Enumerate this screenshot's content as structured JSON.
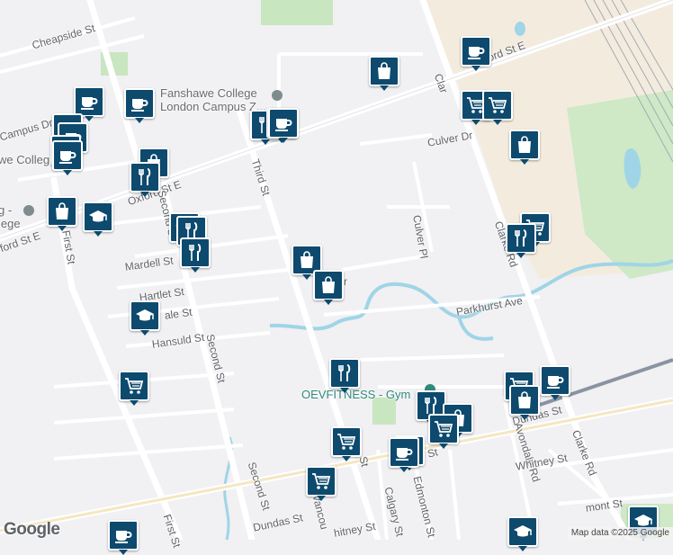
{
  "map": {
    "streets": [
      {
        "id": "cheapside",
        "name": "Cheapside St"
      },
      {
        "id": "oxford-top",
        "name": "ord St E"
      },
      {
        "id": "oxford-mid",
        "name": "Oxford St E"
      },
      {
        "id": "oxford-left",
        "name": "ford St E"
      },
      {
        "id": "campus-dr",
        "name": "Campus Dr"
      },
      {
        "id": "third",
        "name": "Third St"
      },
      {
        "id": "second-upper",
        "name": "Second St"
      },
      {
        "id": "second-lower",
        "name": "Second St"
      },
      {
        "id": "second-bottom",
        "name": "Second St"
      },
      {
        "id": "first",
        "name": "First St"
      },
      {
        "id": "first-bottom",
        "name": "First St"
      },
      {
        "id": "mardell",
        "name": "Mardell St"
      },
      {
        "id": "hartlet",
        "name": "Hartlet St"
      },
      {
        "id": "hansuld",
        "name": "Hansuld St"
      },
      {
        "id": "dale",
        "name": "ale St"
      },
      {
        "id": "culver-dr",
        "name": "Culver Dr"
      },
      {
        "id": "culver-pl",
        "name": "Culver Pl"
      },
      {
        "id": "clarke-top",
        "name": "Clar"
      },
      {
        "id": "clarke-mid",
        "name": "Clarke Rd"
      },
      {
        "id": "clarke-bottom",
        "name": "Clarke Rd"
      },
      {
        "id": "parkhurst",
        "name": "Parkhurst Ave"
      },
      {
        "id": "dundas-right",
        "name": "Dundas St"
      },
      {
        "id": "dundas-left",
        "name": "Dundas St"
      },
      {
        "id": "dundas-mid",
        "name": "as St"
      },
      {
        "id": "avondale",
        "name": "Avondale Rd"
      },
      {
        "id": "whitney",
        "name": "Whitney St"
      },
      {
        "id": "edmonton",
        "name": "Edmonton St"
      },
      {
        "id": "calgary",
        "name": "Calgary St"
      },
      {
        "id": "vancouver",
        "name": "Vancou"
      },
      {
        "id": "whitney-bottom",
        "name": "hitney St"
      },
      {
        "id": "bottom-st",
        "name": "St"
      },
      {
        "id": "belmont",
        "name": "mont St"
      },
      {
        "id": "r-frag",
        "name": "r"
      }
    ],
    "poi_labels": [
      {
        "id": "fanshawe",
        "line1": "Fanshawe College",
        "line2": "London Campus Z..."
      },
      {
        "id": "fanshawe-coll",
        "line1": "we Colleg"
      },
      {
        "id": "college-left",
        "line1": "g -",
        "line2": "lege"
      },
      {
        "id": "gym",
        "line1": "OEVFITNESS - Gym"
      }
    ],
    "pin_types": {
      "cafe": "coffee-cup-icon",
      "restaurant": "fork-knife-icon",
      "shopping": "shopping-bag-icon",
      "grocery": "shopping-cart-icon",
      "school": "graduation-cap-icon"
    },
    "pins": [
      {
        "type": "cafe"
      },
      {
        "type": "shopping"
      },
      {
        "type": "restaurant"
      },
      {
        "type": "grocery"
      },
      {
        "type": "grocery"
      },
      {
        "type": "shopping"
      },
      {
        "type": "cafe"
      },
      {
        "type": "cafe"
      },
      {
        "type": "cafe"
      },
      {
        "type": "cafe"
      },
      {
        "type": "cafe"
      },
      {
        "type": "cafe"
      },
      {
        "type": "restaurant"
      },
      {
        "type": "cafe"
      },
      {
        "type": "shopping"
      },
      {
        "type": "restaurant"
      },
      {
        "type": "shopping"
      },
      {
        "type": "school"
      },
      {
        "type": "school"
      },
      {
        "type": "restaurant"
      },
      {
        "type": "restaurant"
      },
      {
        "type": "shopping"
      },
      {
        "type": "shopping"
      },
      {
        "type": "grocery"
      },
      {
        "type": "restaurant"
      },
      {
        "type": "school"
      },
      {
        "type": "restaurant"
      },
      {
        "type": "grocery"
      },
      {
        "type": "grocery"
      },
      {
        "type": "cafe"
      },
      {
        "type": "shopping"
      },
      {
        "type": "restaurant"
      },
      {
        "type": "shopping"
      },
      {
        "type": "grocery"
      },
      {
        "type": "cafe"
      },
      {
        "type": "grocery"
      },
      {
        "type": "cafe"
      },
      {
        "type": "grocery"
      },
      {
        "type": "school"
      },
      {
        "type": "cafe"
      },
      {
        "type": "school"
      }
    ],
    "colors": {
      "land": "#f1f0f3",
      "road": "#ffffff",
      "water": "#9fd5e6",
      "park": "#c8e6c0",
      "pin": "#0d4a6e",
      "gym": "#2f8a7b",
      "rail": "#8a93a1"
    }
  },
  "footer": {
    "logo": "Google",
    "attribution": "Map data ©2025 Google"
  }
}
